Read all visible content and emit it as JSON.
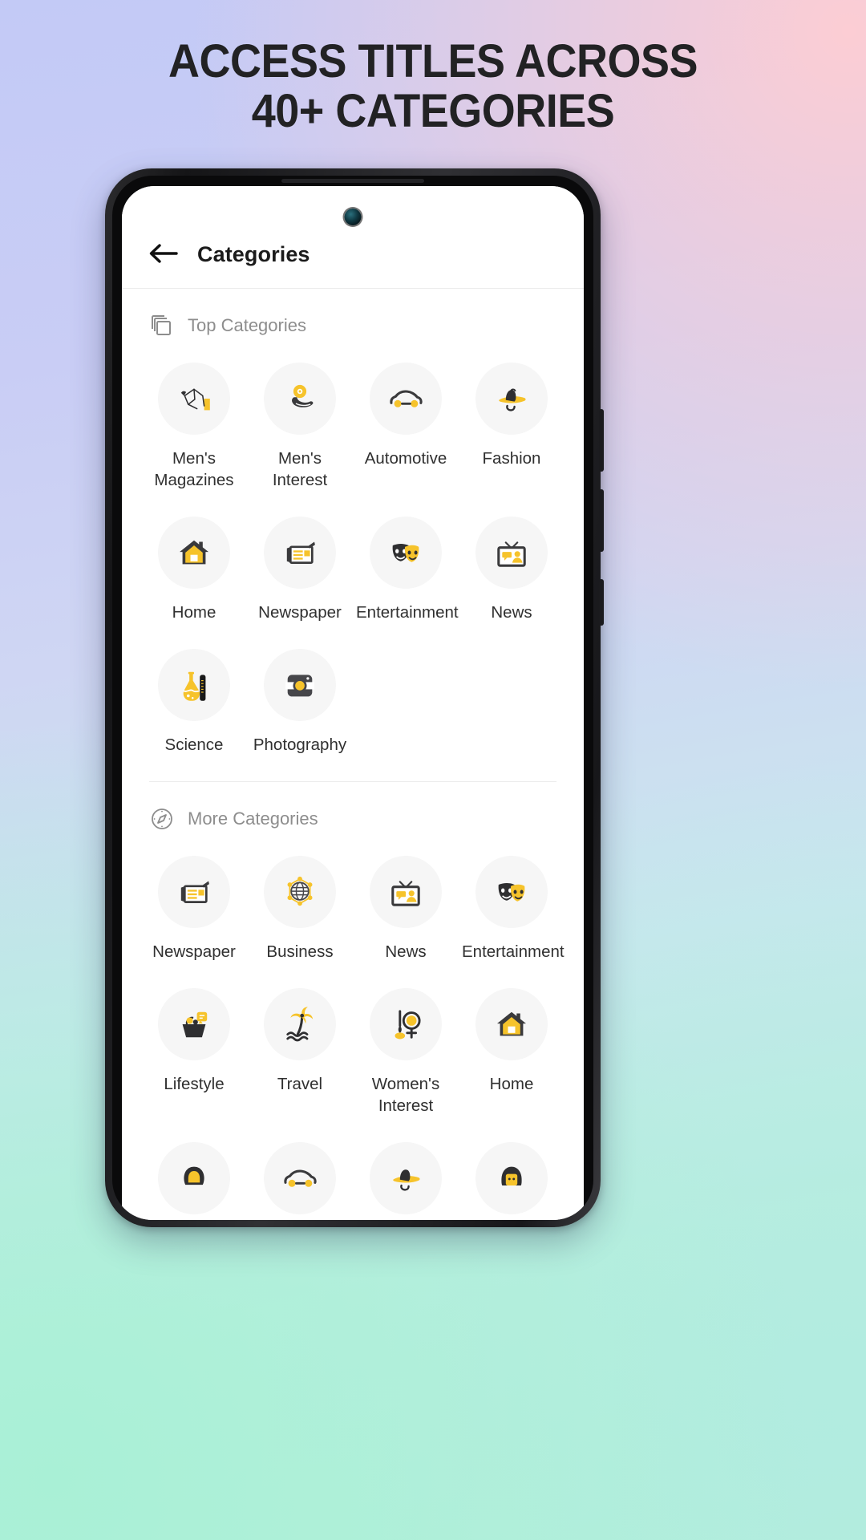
{
  "headline": {
    "line1": "ACCESS TITLES ACROSS",
    "line2": "40+ CATEGORIES"
  },
  "app": {
    "header": {
      "back_icon": "arrow-left-icon",
      "title": "Categories"
    },
    "sections": [
      {
        "id": "top-categories",
        "icon": "layers-icon",
        "label": "Top Categories",
        "items": [
          {
            "label": "Men's Magazines",
            "icon": "mens-magazines-icon"
          },
          {
            "label": "Men's Interest",
            "icon": "dumbbell-icon"
          },
          {
            "label": "Automotive",
            "icon": "car-icon"
          },
          {
            "label": "Fashion",
            "icon": "hat-icon"
          },
          {
            "label": "Home",
            "icon": "house-icon"
          },
          {
            "label": "Newspaper",
            "icon": "newspaper-icon"
          },
          {
            "label": "Entertainment",
            "icon": "theater-masks-icon"
          },
          {
            "label": "News",
            "icon": "tv-news-icon"
          },
          {
            "label": "Science",
            "icon": "flask-icon"
          },
          {
            "label": "Photography",
            "icon": "camera-icon"
          }
        ]
      },
      {
        "id": "more-categories",
        "icon": "compass-icon",
        "label": "More Categories",
        "items": [
          {
            "label": "Newspaper",
            "icon": "newspaper-icon"
          },
          {
            "label": "Business",
            "icon": "globe-network-icon"
          },
          {
            "label": "News",
            "icon": "tv-news-icon"
          },
          {
            "label": "Entertainment",
            "icon": "theater-masks-icon"
          },
          {
            "label": "Lifestyle",
            "icon": "lifestyle-icon"
          },
          {
            "label": "Travel",
            "icon": "palm-tree-icon"
          },
          {
            "label": "Women's Interest",
            "icon": "womens-interest-icon"
          },
          {
            "label": "Home",
            "icon": "house-icon"
          },
          {
            "label": "",
            "icon": "person-hair-icon"
          },
          {
            "label": "",
            "icon": "car-icon"
          },
          {
            "label": "",
            "icon": "hat-icon"
          },
          {
            "label": "",
            "icon": "person-face-icon"
          }
        ]
      }
    ]
  },
  "colors": {
    "accent_yellow": "#F6C32B",
    "dark": "#444446",
    "circle_bg": "#F6F6F6",
    "label": "#303030",
    "section_label": "#8D8D8D"
  }
}
